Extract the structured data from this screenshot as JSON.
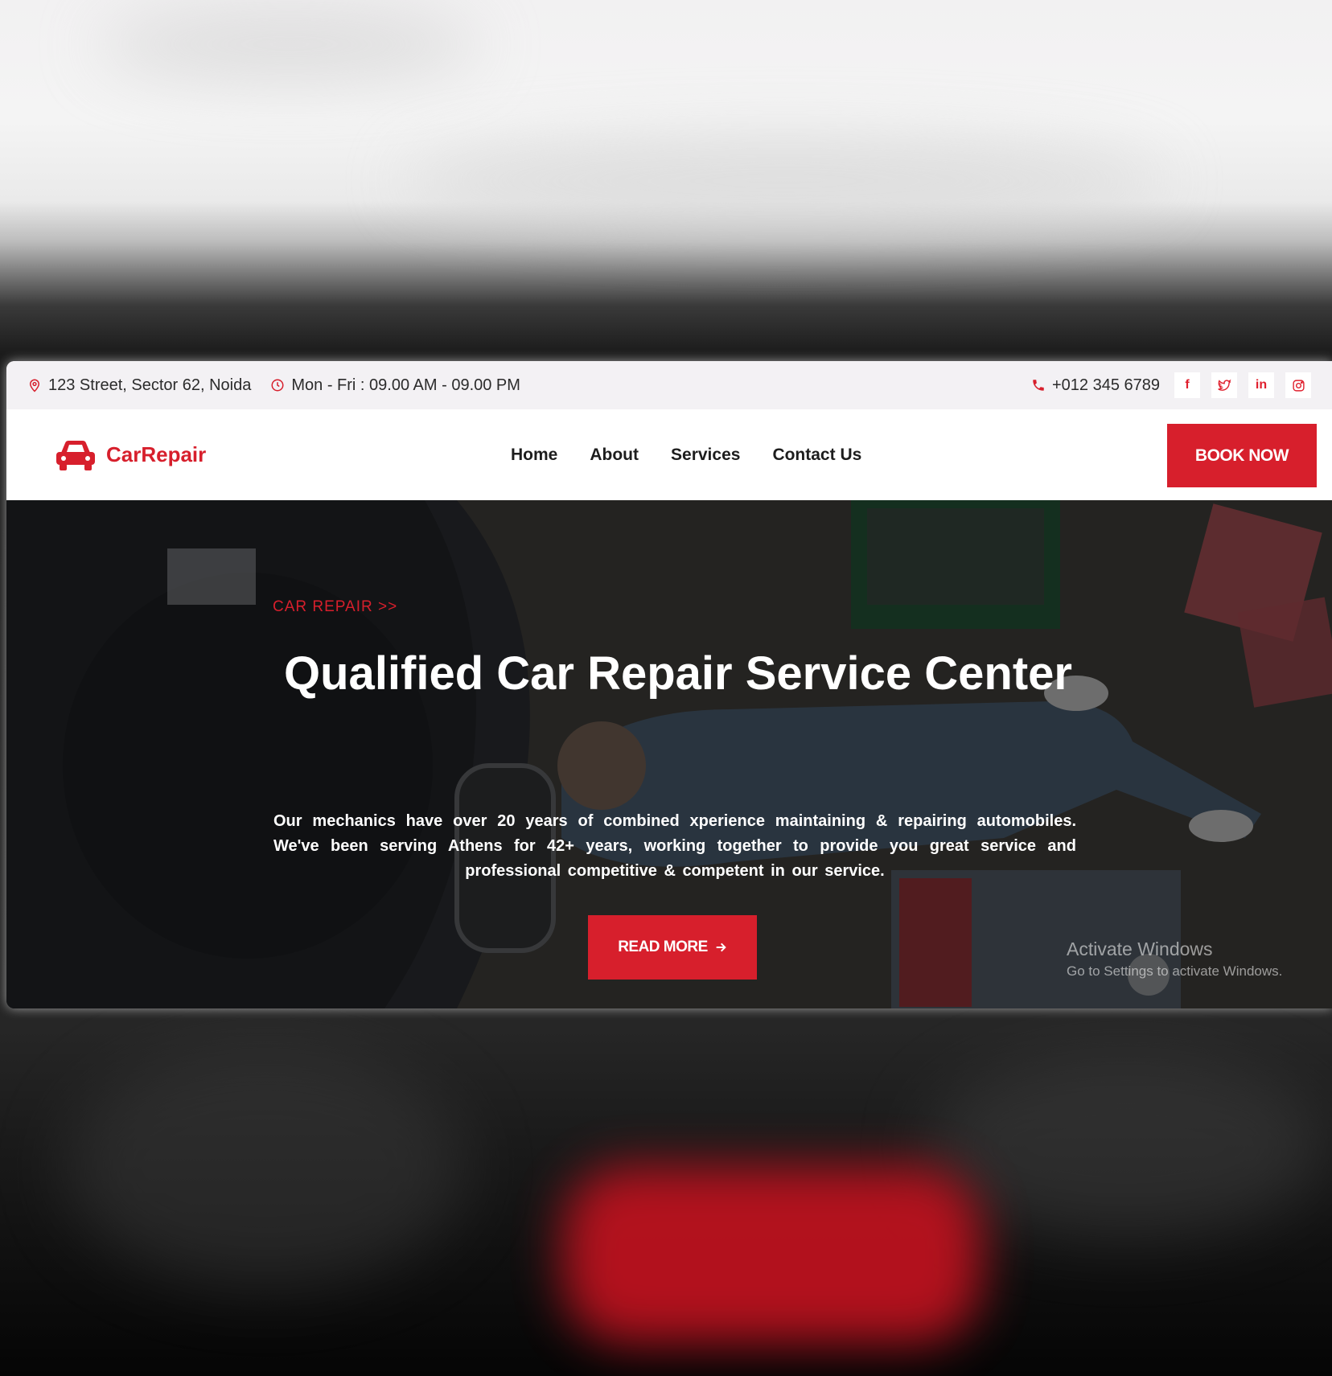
{
  "topbar": {
    "address": "123 Street, Sector 62, Noida",
    "hours": "Mon - Fri : 09.00 AM - 09.00 PM",
    "phone": "+012 345 6789",
    "social": [
      {
        "icon": "facebook-icon",
        "label": "f"
      },
      {
        "icon": "twitter-icon",
        "label": ""
      },
      {
        "icon": "linkedin-icon",
        "label": "in"
      },
      {
        "icon": "instagram-icon",
        "label": ""
      }
    ]
  },
  "navbar": {
    "brand": "CarRepair",
    "links": [
      "Home",
      "About",
      "Services",
      "Contact Us"
    ],
    "cta": "BOOK NOW"
  },
  "hero": {
    "eyebrow": "CAR REPAIR >>",
    "title": "Qualified Car Repair Service Center",
    "text": "Our mechanics have over 20 years of combined xperience maintaining & repairing automobiles. We've been serving Athens for 42+ years, working together to provide you great service and professional competitive & competent in our service.",
    "button": "READ MORE"
  },
  "watermark": {
    "line1": "Activate Windows",
    "line2": "Go to Settings to activate Windows."
  },
  "colors": {
    "accent": "#d71f2c",
    "topbar_bg": "#f3f1f4",
    "hero_overlay": "#0c0a0a"
  }
}
